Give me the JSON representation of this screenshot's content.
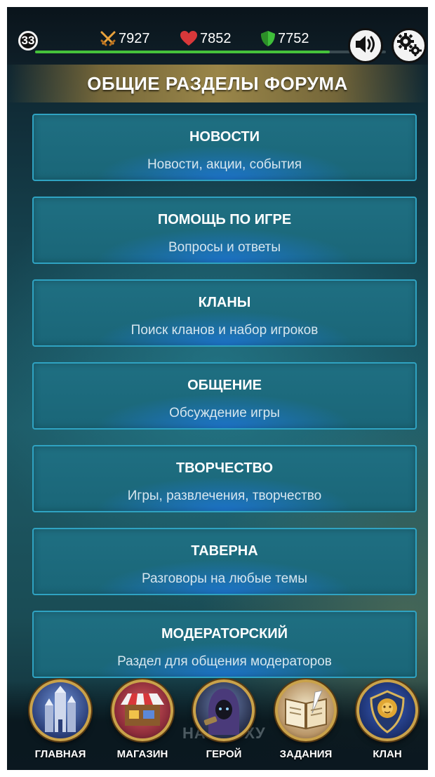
{
  "status_bar": {
    "level": "33",
    "xp_fraction": 0.84,
    "attack": "7927",
    "health": "7852",
    "defense": "7752",
    "icons": {
      "attack": "crossed-swords-icon",
      "health": "heart-icon",
      "defense": "shield-icon",
      "sound": "speaker-icon",
      "settings": "gears-icon"
    },
    "colors": {
      "xp": "#45c23b",
      "attack": "#e8a23c",
      "health": "#d8383a",
      "defense": "#3fbf3a"
    }
  },
  "header": {
    "title": "ОБЩИЕ РАЗДЕЛЫ ФОРУМА"
  },
  "sections": [
    {
      "title": "НОВОСТИ",
      "description": "Новости, акции, события"
    },
    {
      "title": "ПОМОЩЬ ПО ИГРЕ",
      "description": "Вопросы и ответы"
    },
    {
      "title": "КЛАНЫ",
      "description": "Поиск кланов и набор игроков"
    },
    {
      "title": "ОБЩЕНИЕ",
      "description": "Обсуждение игры"
    },
    {
      "title": "ТВОРЧЕСТВО",
      "description": "Игры, развлечения, творчество"
    },
    {
      "title": "ТАВЕРНА",
      "description": "Разговоры на любые темы"
    },
    {
      "title": "МОДЕРАТОРСКИЙ",
      "description": "Раздел для общения модераторов"
    }
  ],
  "footer_ghost_text": "НА ВЕРХУ",
  "bottom_nav": [
    {
      "label": "ГЛАВНАЯ",
      "icon": "castle-icon"
    },
    {
      "label": "МАГАЗИН",
      "icon": "shop-stall-icon"
    },
    {
      "label": "ГЕРОЙ",
      "icon": "hooded-hero-icon"
    },
    {
      "label": "ЗАДАНИЯ",
      "icon": "quest-book-icon"
    },
    {
      "label": "КЛАН",
      "icon": "lion-crest-icon"
    }
  ]
}
